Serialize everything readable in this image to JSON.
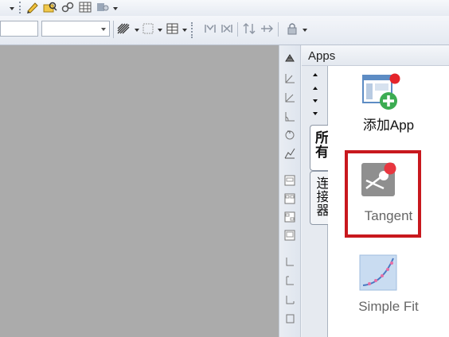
{
  "toolbar": {
    "icons_row1": [
      "pencil-icon",
      "folder-search-icon",
      "link-icon",
      "table-icon",
      "settings-icon"
    ],
    "combo_font_value": "",
    "combo_size_value": "",
    "icons_row2": [
      "pattern-fill-icon",
      "grid-icon",
      "table-layout-icon",
      "merge-icon",
      "split-icon",
      "arrows-updown-icon",
      "arrow-cross-icon",
      "lock-icon"
    ]
  },
  "apps_panel": {
    "title": "Apps",
    "tabs": [
      "所有",
      "连接器"
    ],
    "items": [
      {
        "label": "添加App",
        "icon": "add-app-icon",
        "selected": false
      },
      {
        "label": "Tangent",
        "icon": "tangent-icon",
        "selected": true
      },
      {
        "label": "Simple Fit",
        "icon": "simple-fit-icon",
        "selected": false
      }
    ],
    "highlight_color": "#c8181e"
  },
  "vertical_tools": [
    "layer-icon",
    "axis-icon",
    "axis-xy-icon",
    "axis-angle-icon",
    "rotate-icon",
    "stats-icon",
    "layout-1-icon",
    "layout-2-icon",
    "layout-3-icon",
    "layout-4-icon",
    "corner-1-icon",
    "corner-2-icon",
    "corner-3-icon",
    "corner-4-icon"
  ]
}
